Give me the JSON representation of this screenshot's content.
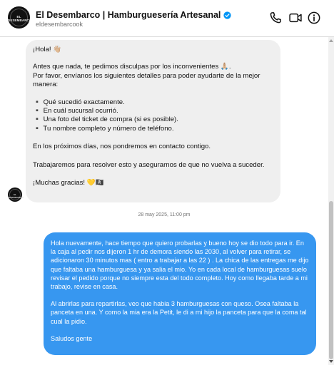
{
  "header": {
    "avatar_text": "EL DESEMBARCO",
    "title": "El Desembarco | Hamburguesería Artesanal",
    "handle": "eldesembarcook",
    "icons": [
      "phone-icon",
      "video-icon",
      "info-icon"
    ],
    "verified_color": "#0095f6"
  },
  "incoming": {
    "lines": [
      "¡Hola! 👋🏼",
      "Antes que nada, te pedimos disculpas por los inconvenientes 🙏🏼.",
      "Por favor, envíanos los siguientes detalles para poder ayudarte de la mejor",
      "manera:",
      "▪️ Qué sucedió exactamente.",
      "▪️ En cuál sucursal ocurrió.",
      "▪️ Una foto del ticket de compra (si es posible).",
      "▪️  Tu nombre completo y número de teléfono.",
      "En los próximos días, nos pondremos en contacto contigo.",
      "Trabajaremos para resolver esto y asegurarnos de que no vuelva a suceder.",
      "¡Muchas gracias! 💛🏴‍☠️"
    ],
    "sender_avatar": "EL DESEMBARCO"
  },
  "timestamp": "28 may 2025, 11:00 pm",
  "outgoing": {
    "paragraph1": "Hola nuevamente, hace tiempo que quiero probarlas y bueno hoy se dio todo para ir. En la caja al pedir nos dijeron 1 hr de demora siendo las 2030, al volver para retirar, se adicionaron 30 minutos mas ( entro a trabajar a las 22 ) . La chica de las entregas me dijo que faltaba una hamburguesa y ya salia el mio. Yo en cada local de hamburguesas suelo revisar el pedido porque no siempre esta del todo completo. Hoy como llegaba tarde a mi trabajo, revise en casa.",
    "paragraph2": "Al abrirlas para repartirlas, veo que habia 3 hamburguesas con queso. Osea faltaba la panceta en una. Y como la mia era la Petit, le di a mi hijo la panceta para que la coma tal cual la pidio.",
    "paragraph3": "Saludos gente",
    "bubble_color": "#3797f0"
  },
  "colors": {
    "incoming_bubble": "#efefef",
    "outgoing_bubble": "#3797f0",
    "muted_text": "#737373"
  }
}
